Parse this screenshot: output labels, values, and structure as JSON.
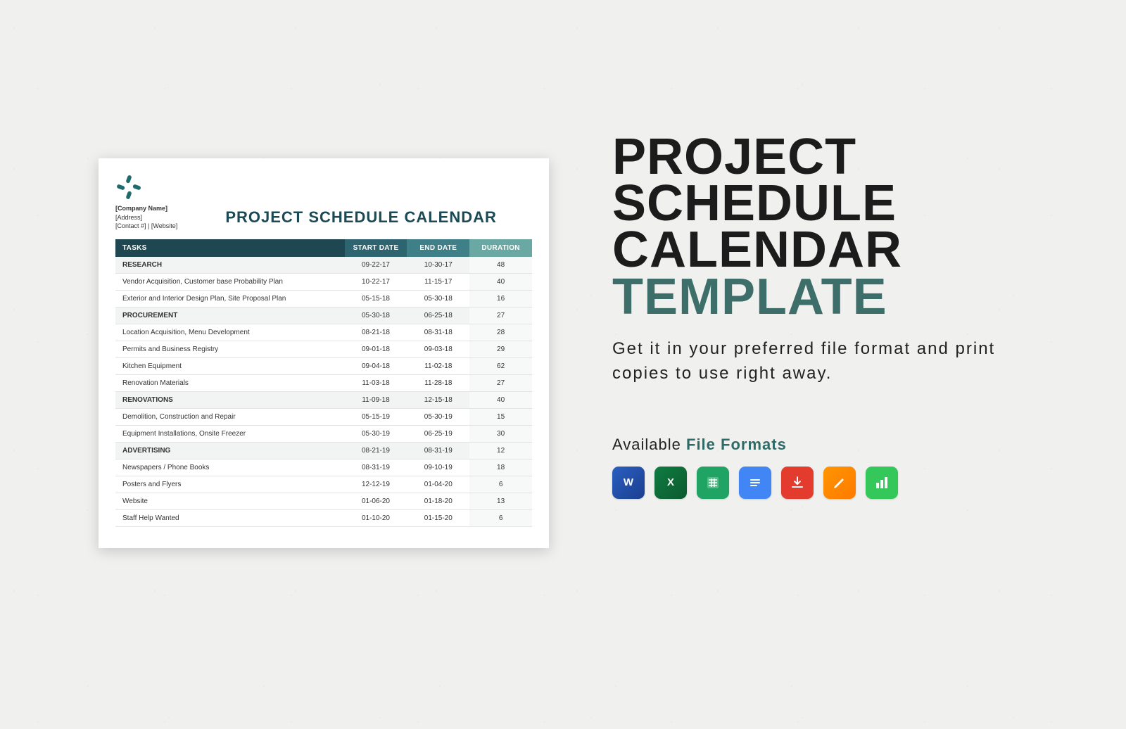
{
  "doc": {
    "company": "[Company Name]",
    "address": "[Address]",
    "contact": "[Contact #]  |  [Website]",
    "title": "PROJECT SCHEDULE CALENDAR",
    "headers": {
      "tasks": "TASKS",
      "start": "START DATE",
      "end": "END DATE",
      "duration": "DURATION"
    },
    "rows": [
      {
        "section": true,
        "task": "RESEARCH",
        "s": "09-22-17",
        "e": "10-30-17",
        "d": "48"
      },
      {
        "section": false,
        "task": "Vendor Acquisition, Customer base Probability Plan",
        "s": "10-22-17",
        "e": "11-15-17",
        "d": "40"
      },
      {
        "section": false,
        "task": "Exterior and Interior Design Plan, Site Proposal Plan",
        "s": "05-15-18",
        "e": "05-30-18",
        "d": "16"
      },
      {
        "section": true,
        "task": "PROCUREMENT",
        "s": "05-30-18",
        "e": "06-25-18",
        "d": "27"
      },
      {
        "section": false,
        "task": "Location Acquisition, Menu Development",
        "s": "08-21-18",
        "e": "08-31-18",
        "d": "28"
      },
      {
        "section": false,
        "task": "Permits and Business Registry",
        "s": "09-01-18",
        "e": "09-03-18",
        "d": "29"
      },
      {
        "section": false,
        "task": "Kitchen Equipment",
        "s": "09-04-18",
        "e": "11-02-18",
        "d": "62"
      },
      {
        "section": false,
        "task": "Renovation Materials",
        "s": "11-03-18",
        "e": "11-28-18",
        "d": "27"
      },
      {
        "section": true,
        "task": "RENOVATIONS",
        "s": "11-09-18",
        "e": "12-15-18",
        "d": "40"
      },
      {
        "section": false,
        "task": "Demolition, Construction and Repair",
        "s": "05-15-19",
        "e": "05-30-19",
        "d": "15"
      },
      {
        "section": false,
        "task": "Equipment Installations, Onsite Freezer",
        "s": "05-30-19",
        "e": "06-25-19",
        "d": "30"
      },
      {
        "section": true,
        "task": "ADVERTISING",
        "s": "08-21-19",
        "e": "08-31-19",
        "d": "12"
      },
      {
        "section": false,
        "task": "Newspapers / Phone Books",
        "s": "08-31-19",
        "e": "09-10-19",
        "d": "18"
      },
      {
        "section": false,
        "task": "Posters and Flyers",
        "s": "12-12-19",
        "e": "01-04-20",
        "d": "6"
      },
      {
        "section": false,
        "task": "Website",
        "s": "01-06-20",
        "e": "01-18-20",
        "d": "13"
      },
      {
        "section": false,
        "task": "Staff Help Wanted",
        "s": "01-10-20",
        "e": "01-15-20",
        "d": "6"
      }
    ]
  },
  "panel": {
    "title_l1": "PROJECT",
    "title_l2": "SCHEDULE",
    "title_l3": "CALENDAR",
    "title_l4": "TEMPLATE",
    "subtitle": "Get it in your preferred file format and print copies to use right away.",
    "formats_a": "Available ",
    "formats_b": "File Formats",
    "icons": [
      {
        "name": "word-icon",
        "label": "W"
      },
      {
        "name": "excel-icon",
        "label": "X"
      },
      {
        "name": "sheets-icon",
        "label": "▦"
      },
      {
        "name": "docs-icon",
        "label": "≡"
      },
      {
        "name": "pdf-icon",
        "label": "⬇"
      },
      {
        "name": "pages-icon",
        "label": "✎"
      },
      {
        "name": "numbers-icon",
        "label": "▮"
      }
    ]
  }
}
